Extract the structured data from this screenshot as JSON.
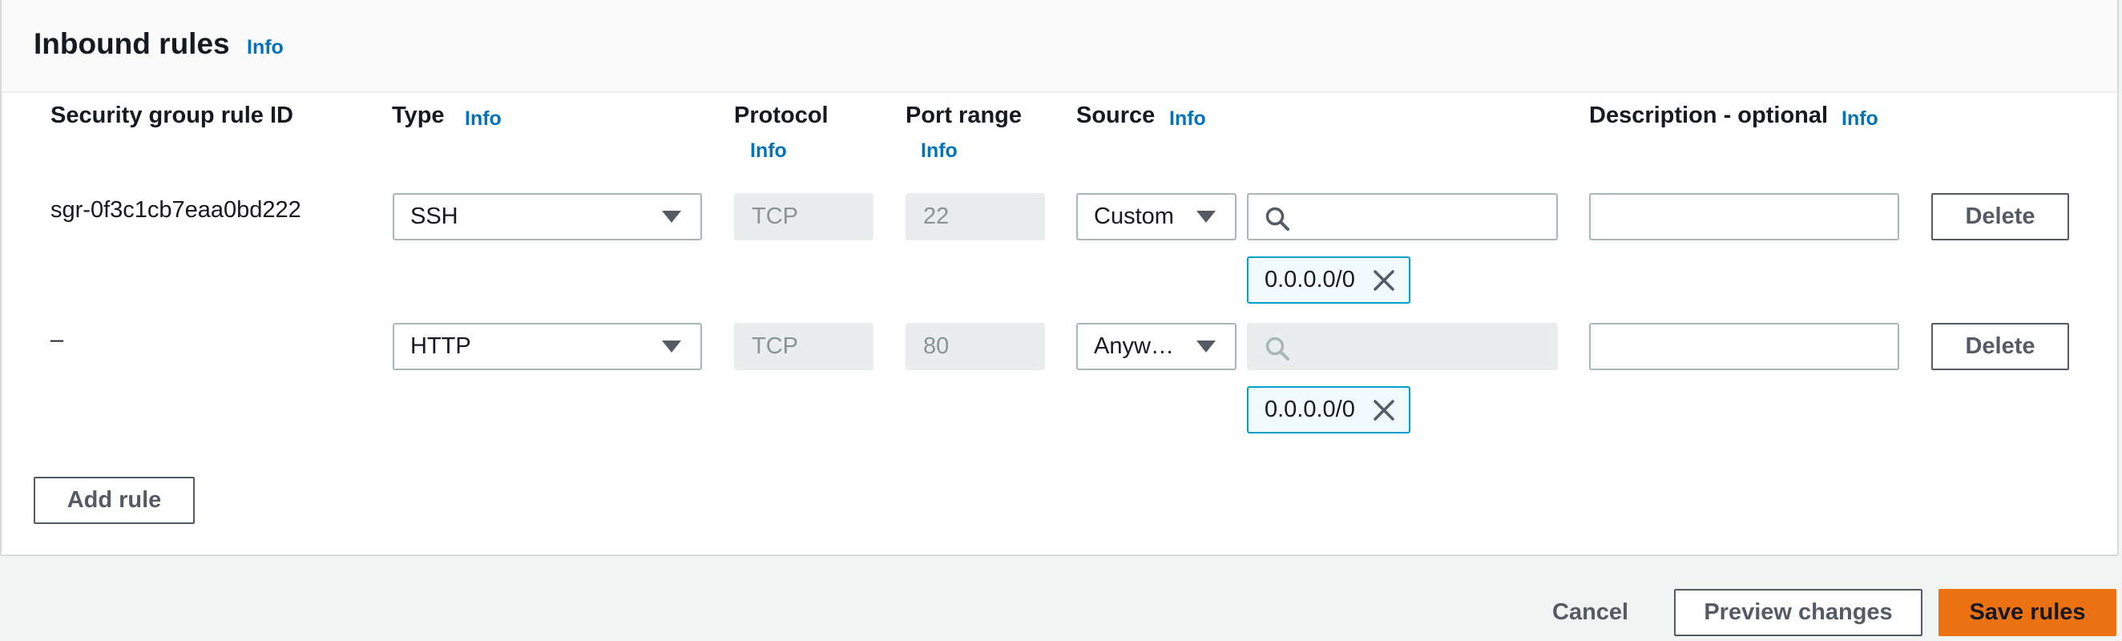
{
  "header": {
    "title": "Inbound rules",
    "info": "Info"
  },
  "columns": {
    "rule_id": "Security group rule ID",
    "type": "Type",
    "type_info": "Info",
    "protocol": "Protocol",
    "protocol_info": "Info",
    "port_range": "Port range",
    "port_range_info": "Info",
    "source": "Source",
    "source_info": "Info",
    "description": "Description - optional",
    "description_info": "Info"
  },
  "rules": [
    {
      "id": "sgr-0f3c1cb7eaa0bd222",
      "type": "SSH",
      "protocol": "TCP",
      "port_range": "22",
      "source_type": "Custom",
      "search_value": "",
      "search_disabled": false,
      "cidr_token": "0.0.0.0/0",
      "description": "",
      "delete_label": "Delete"
    },
    {
      "id": "–",
      "type": "HTTP",
      "protocol": "TCP",
      "port_range": "80",
      "source_type": "Anywh…",
      "search_value": "",
      "search_disabled": true,
      "cidr_token": "0.0.0.0/0",
      "description": "",
      "delete_label": "Delete"
    }
  ],
  "actions": {
    "add_rule": "Add rule",
    "cancel": "Cancel",
    "preview": "Preview changes",
    "save": "Save rules"
  },
  "colors": {
    "link": "#0073bb",
    "primary": "#ec7211",
    "token_border": "#00a1c9",
    "token_bg": "#f1faff"
  }
}
